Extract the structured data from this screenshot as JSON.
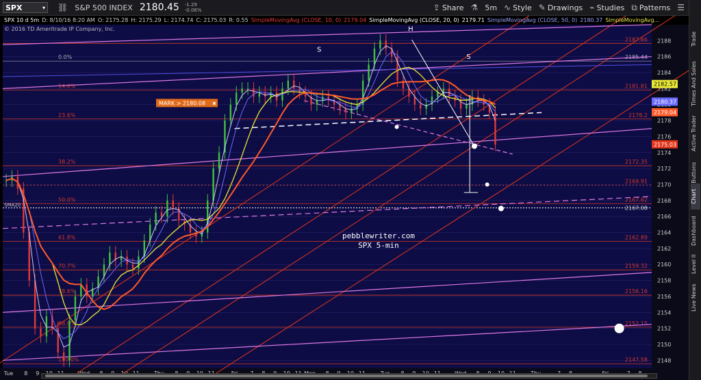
{
  "toolbar": {
    "symbol": "SPX",
    "symbol_name": "S&P 500 INDEX",
    "last_price": "2180.45",
    "change": "-1.29",
    "change_pct": "-0.06%",
    "share_label": "Share",
    "interval_label": "5m",
    "style_label": "Style",
    "drawings_label": "Drawings",
    "studies_label": "Studies",
    "patterns_label": "Patterns"
  },
  "infobar": {
    "symbol_period": "SPX 10 d 5m",
    "date": "D: 8/10/16 8:20 AM",
    "open": "O: 2175.28",
    "high": "H: 2175.29",
    "low": "L: 2174.74",
    "close": "C: 2175.03",
    "range": "R: 0.55",
    "sma10": "SimpleMovingAvg (CLOSE, 10, 0)",
    "sma10_val": "2179.04",
    "sma20": "SimpleMovingAvg (CLOSE, 20, 0)",
    "sma20_val": "2179.71",
    "sma50": "SimpleMovingAvg (CLOSE, 50, 0)",
    "sma50_val": "2180.37",
    "sma_trunc": "SimpleMovingAvg..."
  },
  "copyright": "© 2016 TD Ameritrade IP Company, Inc.",
  "sidebar_tabs": [
    "Trade",
    "Times And Sales",
    "Active Trader",
    "Big Buttons",
    "Chart",
    "Dashboard",
    "Level II",
    "Live News"
  ],
  "watermark": {
    "line1": "pebblewriter.com",
    "line2": "SPX 5-min"
  },
  "mark_label": "MARK > 2180.08",
  "colors": {
    "bg": "#0e0c45",
    "grid": "#2a2870",
    "fib": "#d23a28",
    "channel": "#e2361c",
    "sma10": "#ff5a2a",
    "sma20": "#c8c8ff",
    "sma50": "#6a6aff",
    "sma_yellow": "#e8e838",
    "pink": "#e07ae6"
  },
  "chart_data": {
    "type": "candlestick",
    "y_axis": {
      "min": 2147,
      "max": 2190,
      "ticks": [
        2148,
        2150,
        2152,
        2154,
        2156,
        2158,
        2160,
        2162,
        2164,
        2166,
        2168,
        2170,
        2172,
        2174,
        2176,
        2178,
        2180,
        2182,
        2184,
        2186,
        2188
      ]
    },
    "x_axis_labels": [
      {
        "t": "Tue",
        "x": 0.5
      },
      {
        "t": "8",
        "x": 2
      },
      {
        "t": "9",
        "x": 3
      },
      {
        "t": "10",
        "x": 4
      },
      {
        "t": "11",
        "x": 5
      },
      {
        "t": "Wed",
        "x": 7
      },
      {
        "t": "8",
        "x": 8.5
      },
      {
        "t": "9",
        "x": 9.5
      },
      {
        "t": "10",
        "x": 10.5
      },
      {
        "t": "11",
        "x": 11.5
      },
      {
        "t": "Thu",
        "x": 13.5
      },
      {
        "t": "8",
        "x": 15
      },
      {
        "t": "9",
        "x": 16
      },
      {
        "t": "10",
        "x": 17
      },
      {
        "t": "11",
        "x": 18
      },
      {
        "t": "Fri",
        "x": 20
      },
      {
        "t": "7",
        "x": 21.5
      },
      {
        "t": "8",
        "x": 22.5
      },
      {
        "t": "9",
        "x": 23.5
      },
      {
        "t": "10",
        "x": 24.5
      },
      {
        "t": "11",
        "x": 25.5
      },
      {
        "t": "Mon",
        "x": 26.5
      },
      {
        "t": "8",
        "x": 28
      },
      {
        "t": "9",
        "x": 29
      },
      {
        "t": "10",
        "x": 30
      },
      {
        "t": "11",
        "x": 31
      },
      {
        "t": "Tue",
        "x": 33
      },
      {
        "t": "8",
        "x": 34.5
      },
      {
        "t": "9",
        "x": 35.5
      },
      {
        "t": "10",
        "x": 36.5
      },
      {
        "t": "11",
        "x": 37.5
      },
      {
        "t": "Wed",
        "x": 39.5
      },
      {
        "t": "8",
        "x": 41
      },
      {
        "t": "9",
        "x": 42
      },
      {
        "t": "10",
        "x": 43
      },
      {
        "t": "11",
        "x": 44
      },
      {
        "t": "Thu",
        "x": 46
      },
      {
        "t": "7",
        "x": 48
      },
      {
        "t": "8",
        "x": 49
      },
      {
        "t": "Fri",
        "x": 52
      },
      {
        "t": "7",
        "x": 54
      },
      {
        "t": "8",
        "x": 55
      }
    ],
    "x_range": [
      0,
      56
    ],
    "fib_levels": [
      {
        "label": "0.0%",
        "value": 2185.44,
        "price_label": "2185.44",
        "line": "gray"
      },
      {
        "label": "14.6%",
        "value": 2181.81,
        "price_label": "2181.81"
      },
      {
        "label": "23.6%",
        "value": 2178.2,
        "price_label": "2178.2"
      },
      {
        "label": "38.2%",
        "value": 2172.35,
        "price_label": "2172.35"
      },
      {
        "label": "50.0%",
        "value": 2167.62,
        "price_label": "2167.62"
      },
      {
        "label": "61.8%",
        "value": 2162.89,
        "price_label": "2162.89"
      },
      {
        "label": "70.7%",
        "value": 2159.32,
        "price_label": "2159.32"
      },
      {
        "label": "78.6%",
        "value": 2156.16,
        "price_label": "2156.16"
      },
      {
        "label": "88.6%",
        "value": 2152.15,
        "price_label": "2152.15"
      },
      {
        "label": "100.0%",
        "value": 2147.58,
        "price_label": "2147.58"
      }
    ],
    "top_level": {
      "value": 2187.66,
      "price_label": "2187.66"
    },
    "dotted_red": {
      "value": 2169.91,
      "price_label": "2169.91"
    },
    "dotted_white": {
      "value": 2167.08,
      "price_label": "2167.08",
      "label": "SMA20"
    },
    "axis_tags": [
      {
        "value": 2182.57,
        "text": "2182.57",
        "bg": "#e8e838",
        "fg": "#000"
      },
      {
        "value": 2180.37,
        "text": "2180.37",
        "bg": "#6a6aff",
        "fg": "#fff"
      },
      {
        "value": 2179.04,
        "text": "2179.04",
        "bg": "#ff5a2a",
        "fg": "#fff"
      },
      {
        "value": 2175.03,
        "text": "2175.03",
        "bg": "#e2361c",
        "fg": "#fff"
      }
    ],
    "pattern_labels": [
      {
        "t": "S",
        "x": 27.3,
        "y": 2186.6
      },
      {
        "t": "H",
        "x": 35.2,
        "y": 2189.2
      },
      {
        "t": "S",
        "x": 40.2,
        "y": 2185.7
      }
    ],
    "closes": [
      2170.5,
      2171,
      2169.5,
      2164,
      2158,
      2152,
      2151,
      2153.5,
      2152,
      2149,
      2148,
      2153,
      2156,
      2157.5,
      2156,
      2157,
      2158.5,
      2160,
      2161.5,
      2160.5,
      2161,
      2160,
      2159.5,
      2161,
      2163,
      2165,
      2166.5,
      2166,
      2168,
      2167,
      2165.5,
      2165,
      2164,
      2163.5,
      2164,
      2168,
      2172,
      2174,
      2178,
      2180,
      2181.5,
      2182,
      2182,
      2181,
      2181.5,
      2181,
      2181.5,
      2180.5,
      2182,
      2183,
      2182,
      2181.5,
      2181,
      2180,
      2180.5,
      2181,
      2180.5,
      2180,
      2179.5,
      2179,
      2179.5,
      2180,
      2183,
      2185,
      2187,
      2188,
      2187,
      2186,
      2183,
      2182,
      2181,
      2180,
      2179.5,
      2180,
      2181,
      2181.5,
      2182,
      2181,
      2180.5,
      2179.5,
      2180,
      2181,
      2180.5,
      2180,
      2179,
      2175
    ]
  }
}
